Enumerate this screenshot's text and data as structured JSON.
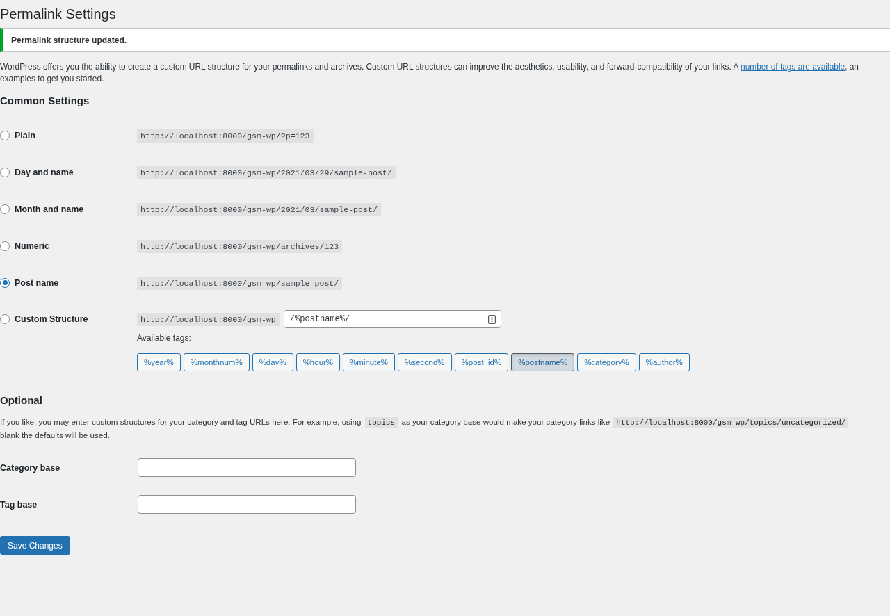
{
  "page_title": "Permalink Settings",
  "notice": {
    "message": "Permalink structure updated."
  },
  "intro": {
    "before_link": "WordPress offers you the ability to create a custom URL structure for your permalinks and archives. Custom URL structures can improve the aesthetics, usability, and forward-compatibility of your links. A ",
    "link": "number of tags are available",
    "after_link": ", an",
    "line_2": "examples to get you started."
  },
  "common_settings": {
    "heading": "Common Settings",
    "options": [
      {
        "kind": "example",
        "label": "Plain",
        "example": "http://localhost:8000/gsm-wp/?p=123",
        "selected": false
      },
      {
        "kind": "example",
        "label": "Day and name",
        "example": "http://localhost:8000/gsm-wp/2021/03/29/sample-post/",
        "selected": false
      },
      {
        "kind": "example",
        "label": "Month and name",
        "example": "http://localhost:8000/gsm-wp/2021/03/sample-post/",
        "selected": false
      },
      {
        "kind": "example",
        "label": "Numeric",
        "example": "http://localhost:8000/gsm-wp/archives/123",
        "selected": false
      },
      {
        "kind": "example",
        "label": "Post name",
        "example": "http://localhost:8000/gsm-wp/sample-post/",
        "selected": true
      },
      {
        "kind": "custom",
        "label": "Custom Structure",
        "prefix": "http://localhost:8000/gsm-wp",
        "value": "/%postname%/",
        "selected": false,
        "tags_label": "Available tags:",
        "tags": [
          {
            "label": "%year%",
            "selected": false
          },
          {
            "label": "%monthnum%",
            "selected": false
          },
          {
            "label": "%day%",
            "selected": false
          },
          {
            "label": "%hour%",
            "selected": false
          },
          {
            "label": "%minute%",
            "selected": false
          },
          {
            "label": "%second%",
            "selected": false
          },
          {
            "label": "%post_id%",
            "selected": false
          },
          {
            "label": "%postname%",
            "selected": true
          },
          {
            "label": "%category%",
            "selected": false
          },
          {
            "label": "%author%",
            "selected": false
          }
        ]
      }
    ]
  },
  "optional": {
    "heading": "Optional",
    "description": {
      "text_1": "If you like, you may enter custom structures for your category and tag URLs here. For example, using ",
      "code_1": "topics",
      "text_2": " as your category base would make your category links like ",
      "code_2": "http://localhost:8000/gsm-wp/topics/uncategorized/",
      "line_2": "blank the defaults will be used."
    },
    "fields": [
      {
        "label": "Category base"
      },
      {
        "label": "Tag base"
      }
    ]
  },
  "save_button": "Save Changes"
}
